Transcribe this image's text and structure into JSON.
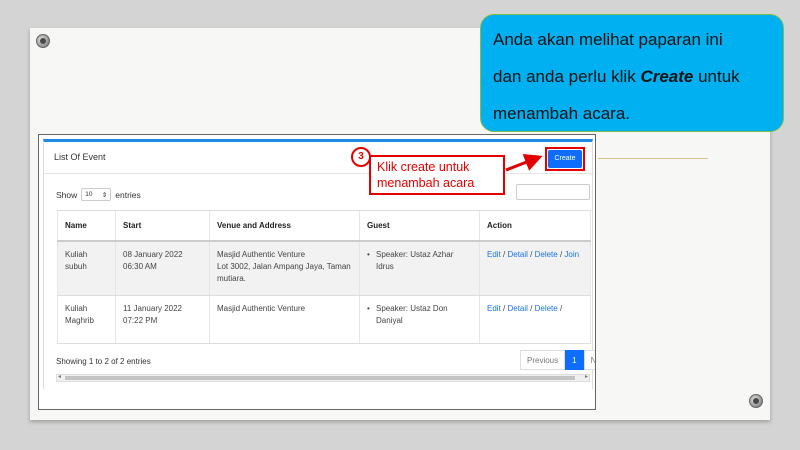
{
  "callout": {
    "line1": "Anda akan melihat paparan ini",
    "line2_pre": "dan anda perlu klik ",
    "line2_bold": "Create",
    "line2_post": " untuk",
    "line3": "menambah acara."
  },
  "annotation": {
    "step": "3",
    "text_line1": "Klik create untuk",
    "text_line2": "menambah acara"
  },
  "card": {
    "title": "List Of Event",
    "create_label": "Create"
  },
  "length_control": {
    "prefix": "Show",
    "value": "10",
    "suffix": "entries"
  },
  "table": {
    "headers": [
      "Name",
      "Start",
      "Venue and Address",
      "Guest",
      "Action"
    ],
    "rows": [
      {
        "name": "Kuliah subuh",
        "start_date": "08 January 2022",
        "start_time": "06:30 AM",
        "venue_line1": "Masjid Authentic Venture",
        "venue_line2": "Lot 3002, Jalan Ampang Jaya, Taman mutiara.",
        "guest": "Speaker: Ustaz Azhar Idrus",
        "actions": [
          "Edit",
          "Detail",
          "Delete",
          "Join"
        ]
      },
      {
        "name": "Kuliah Maghrib",
        "start_date": "11 January 2022",
        "start_time": "07:22 PM",
        "venue_line1": "Masjid Authentic Venture",
        "venue_line2": "",
        "guest": "Speaker: Ustaz Don Daniyal",
        "actions": [
          "Edit",
          "Detail",
          "Delete"
        ]
      }
    ]
  },
  "info": "Showing 1 to 2 of 2 entries",
  "pagination": {
    "previous": "Previous",
    "current": "1",
    "next": "Next"
  },
  "colors": {
    "accent": "#0d6efd",
    "callout": "#00b0f0",
    "annotation": "#e30000"
  }
}
